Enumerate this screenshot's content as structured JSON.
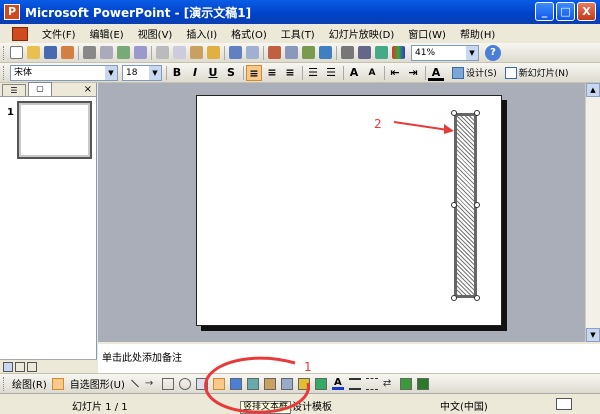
{
  "window": {
    "title": "Microsoft PowerPoint - [演示文稿1]",
    "minimize": "_",
    "maximize": "□",
    "close": "X"
  },
  "menu": [
    "文件(F)",
    "编辑(E)",
    "视图(V)",
    "插入(I)",
    "格式(O)",
    "工具(T)",
    "幻灯片放映(D)",
    "窗口(W)",
    "帮助(H)"
  ],
  "toolbar_standard": {
    "zoom": "41%"
  },
  "toolbar_format": {
    "font": "宋体",
    "size": "18",
    "bold": "B",
    "italic": "I",
    "underline": "U",
    "shadow": "S",
    "design": "设计(S)",
    "new_slide": "新幻灯片(N)"
  },
  "outline_tabs": {
    "close": "×"
  },
  "slide_panel": {
    "number": "1"
  },
  "notes": {
    "placeholder": "单击此处添加备注"
  },
  "drawing_toolbar": {
    "draw": "绘图(R)",
    "autoshapes": "自选图形(U)"
  },
  "tooltip": "竖排文本框",
  "status": {
    "slide": "幻灯片 1 / 1",
    "template": "默认设计模板",
    "language": "中文(中国)"
  },
  "annotations": {
    "one": "1",
    "two": "2"
  },
  "colors": {
    "title_bar": "#0041c8",
    "annotation": "#e83a3a",
    "workspace": "#a9aeb8"
  }
}
